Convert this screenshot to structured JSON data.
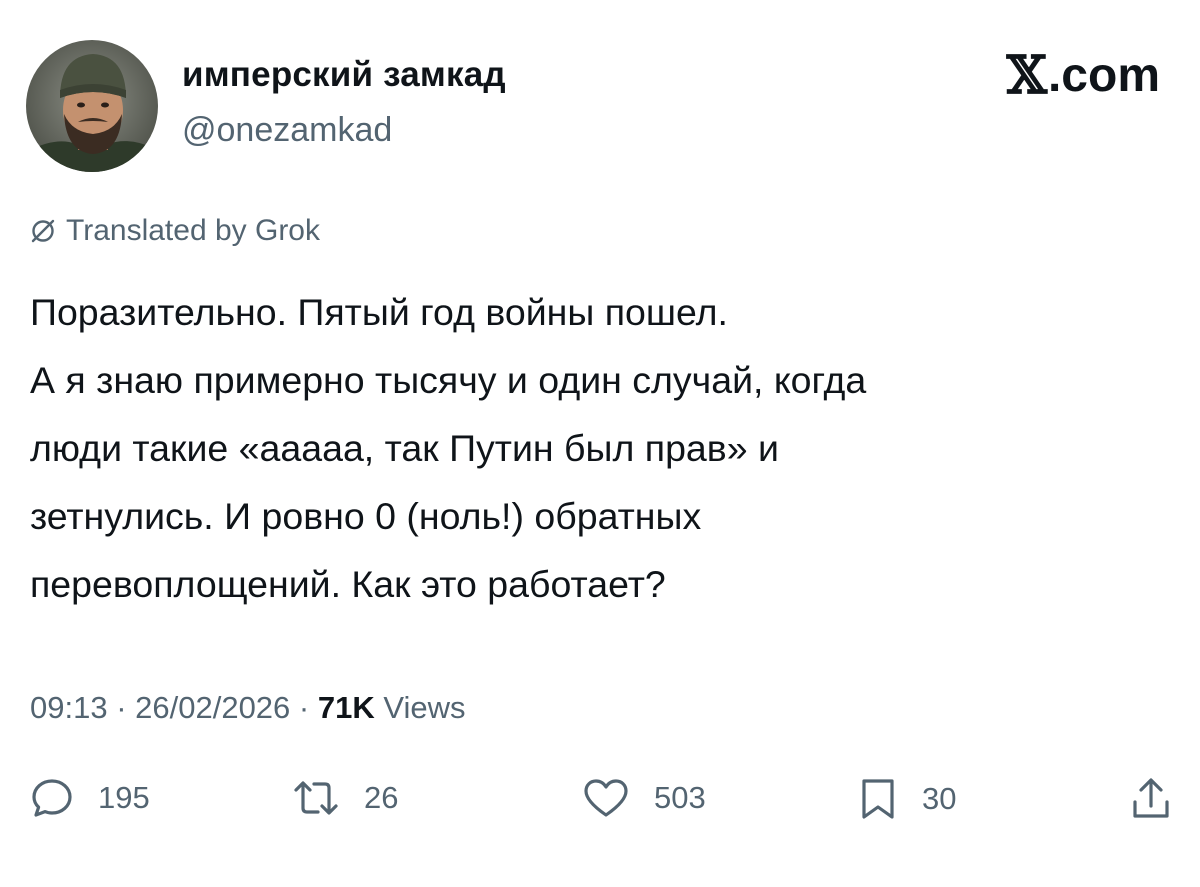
{
  "author": {
    "name": "имперский замкад",
    "handle": "@onezamkad",
    "avatar_icon": "avatar-photo"
  },
  "brand": {
    "logo_glyph": "𝕏",
    "text": ".com"
  },
  "translation": {
    "icon": "translate-icon",
    "label": "Translated by Grok"
  },
  "post": {
    "lines": [
      "Поразительно. Пятый год войны пошел.",
      "А я знаю примерно тысячу и один случай, когда",
      "люди такие «ааааа, так Путин был прав» и",
      "зетнулись. И ровно 0 (ноль!) обратных",
      "перевоплощений. Как это работает?"
    ]
  },
  "meta": {
    "time": "09:13",
    "separator": " · ",
    "date": "26/02/2026",
    "views_count": "71K",
    "views_label": " Views"
  },
  "actions": {
    "replies": "195",
    "reposts": "26",
    "likes": "503",
    "bookmarks": "30"
  },
  "colors": {
    "text_primary": "#0f1419",
    "text_secondary": "#536471",
    "background": "#ffffff"
  }
}
